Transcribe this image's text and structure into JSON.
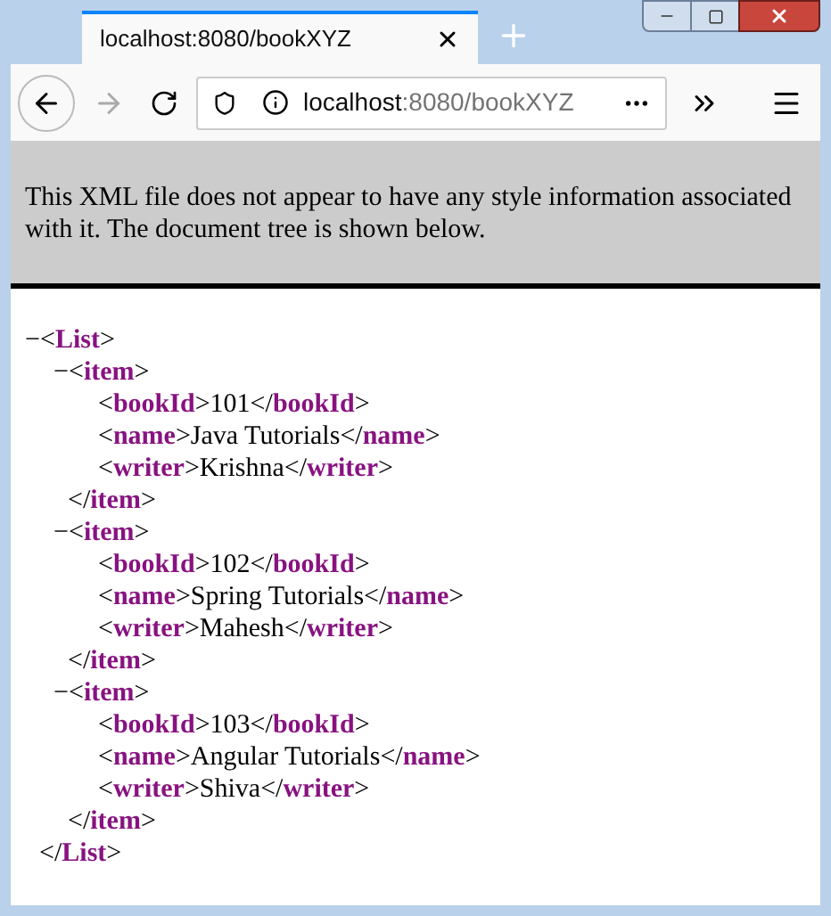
{
  "tab": {
    "title": "localhost:8080/bookXYZ",
    "selected": true
  },
  "address_bar": {
    "host": "localhost",
    "path": ":8080/bookXYZ"
  },
  "info_banner": "This XML file does not appear to have any style information associated with it. The document tree is shown below.",
  "xml_tree": [
    {
      "toggle": "−",
      "text": "<**List**>",
      "close": "</**List**>",
      "children": [
        {
          "toggle": "−",
          "text": "<**item**>",
          "close": "</**item**>",
          "children": [
            {
              "text": "<**bookId**>101</**bookId**>"
            },
            {
              "text": "<**name**>Java Tutorials</**name**>"
            },
            {
              "text": "<**writer**>Krishna</**writer**>"
            }
          ]
        },
        {
          "toggle": "−",
          "text": "<**item**>",
          "close": "</**item**>",
          "children": [
            {
              "text": "<**bookId**>102</**bookId**>"
            },
            {
              "text": "<**name**>Spring Tutorials</**name**>"
            },
            {
              "text": "<**writer**>Mahesh</**writer**>"
            }
          ]
        },
        {
          "toggle": "−",
          "text": "<**item**>",
          "close": "</**item**>",
          "children": [
            {
              "text": "<**bookId**>103</**bookId**>"
            },
            {
              "text": "<**name**>Angular Tutorials</**name**>"
            },
            {
              "text": "<**writer**>Shiva</**writer**>"
            }
          ]
        }
      ]
    }
  ]
}
